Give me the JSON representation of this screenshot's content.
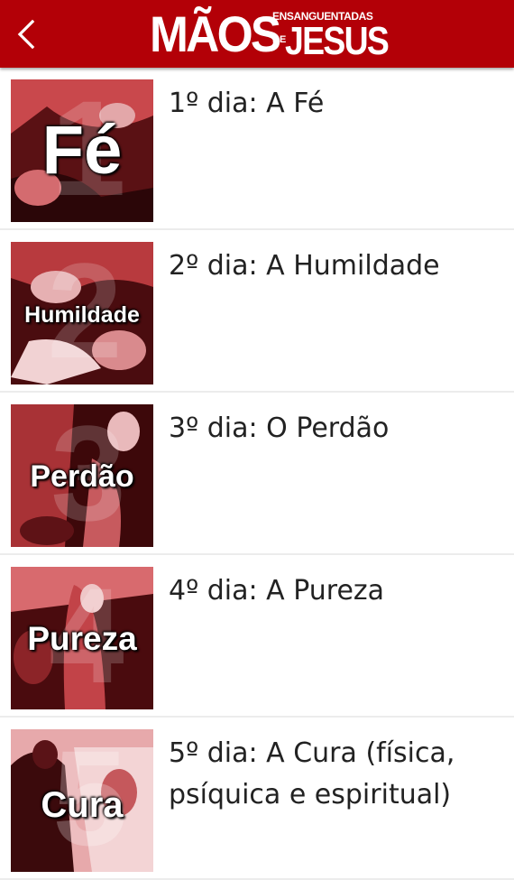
{
  "header": {
    "logo_main": "MÃOS",
    "logo_small": "ENSANGUENTADAS",
    "logo_de": "DE",
    "logo_jesus": "JESUS",
    "background_color": "#b30007",
    "back_icon": "chevron-left-icon"
  },
  "items": [
    {
      "title": "1º dia: A Fé",
      "thumb_word": "Fé",
      "thumb_numeral": "1"
    },
    {
      "title": "2º dia: A Humildade",
      "thumb_word": "Humildade",
      "thumb_numeral": "2"
    },
    {
      "title": "3º dia: O Perdão",
      "thumb_word": "Perdão",
      "thumb_numeral": "3"
    },
    {
      "title": "4º dia: A Pureza",
      "thumb_word": "Pureza",
      "thumb_numeral": "4"
    },
    {
      "title": "5º dia: A Cura (física, psíquica e espiritual)",
      "thumb_word": "Cura",
      "thumb_numeral": "5"
    }
  ]
}
